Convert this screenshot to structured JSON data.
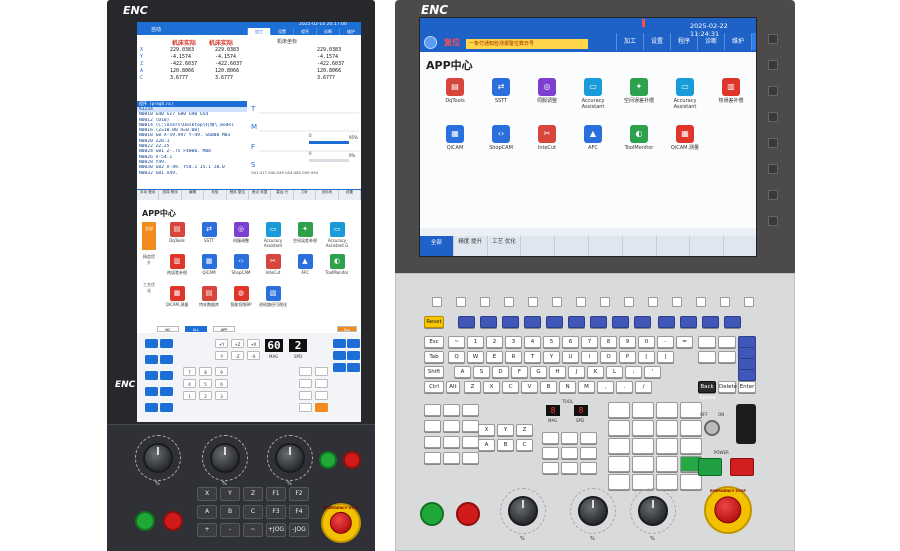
{
  "left": {
    "logo": "ENC",
    "screen": {
      "mode": "自动",
      "time": "2025-02-14 20:17:00",
      "tabs": [
        {
          "label": "加工",
          "active": true
        },
        {
          "label": "设置",
          "active": false
        },
        {
          "label": "程序",
          "active": false
        },
        {
          "label": "诊断",
          "active": false
        },
        {
          "label": "维护",
          "active": false
        }
      ],
      "coord_headers": [
        "机床实际",
        "机床实际",
        "机床坐标"
      ],
      "axes": [
        {
          "axis": "X",
          "v1": "229.0383",
          "v2": "229.0383"
        },
        {
          "axis": "Y",
          "v1": "-4.1574",
          "v2": "-4.1574"
        },
        {
          "axis": "Z",
          "v1": "-422.6037",
          "v2": "-422.6037"
        },
        {
          "axis": "A",
          "v1": "120.8066",
          "v2": "120.8066"
        },
        {
          "axis": "C",
          "v1": "3.6777",
          "v2": "3.6777"
        }
      ],
      "coord_right": [
        "229.0383",
        "-4.1574",
        "-422.6037",
        "120.8066",
        "3.6777"
      ],
      "program_title": "程序 (prog0.nc)",
      "program_lines": [
        "%1234",
        "N0010 G40 G17 G00 G90 G54",
        "N0012 (D10)",
        "N0014 (C:\\Users\\Desktop\\打样\\_model",
        "N0016 (Z=10.00 R=0.00)",
        "N0018 G0 X-59.997 Y-49. S6000 M03",
        "N0020 Z20.1",
        "N0022 Z2.25",
        "N0024 G01 Z-.75 F4000. M08",
        "N0026 X-54.1",
        "N0028 Y49.",
        "N0030 G02 X-49. Y54.1 I5.1 J0.0",
        "N0032 G01 X49."
      ],
      "status": {
        "T": "T",
        "M": "M",
        "F": "F",
        "S": "S",
        "gcodes": "G01 G17 G40 G49 G54 G80 G90 G94",
        "feed": "0",
        "speed": "0",
        "pct1": "95%",
        "pct2": "0%"
      },
      "softkeys": [
        "手动 程序",
        "选择 程序",
        "编辑",
        "校验",
        "程序 复位",
        "断点 恢复",
        "重运 行",
        "刀补",
        "坐标系",
        "设置"
      ],
      "app_title": "APP中心",
      "app_side": [
        "全部",
        "精度提升",
        "工艺优化"
      ],
      "apps": [
        {
          "label": "DqTools",
          "color": "#d6463c",
          "glyph": "▤"
        },
        {
          "label": "SSTT",
          "color": "#2a6fdc",
          "glyph": "⇄"
        },
        {
          "label": "伺服调整",
          "color": "#7c3fd0",
          "glyph": "◎"
        },
        {
          "label": "Accuracy Assistant",
          "color": "#1a9bd9",
          "glyph": "▭"
        },
        {
          "label": "空间误差补偿",
          "color": "#2da14b",
          "glyph": "✦"
        },
        {
          "label": "Accuracy Assistant.G",
          "color": "#1a9bd9",
          "glyph": "▭"
        },
        {
          "label": "热误差补偿",
          "color": "#e0352b",
          "glyph": "▥"
        },
        {
          "label": "QiCAM",
          "color": "#2a6fdc",
          "glyph": "▦"
        },
        {
          "label": "ShopCAM",
          "color": "#2a6fdc",
          "glyph": "‹›"
        },
        {
          "label": "InteCut",
          "color": "#d6463c",
          "glyph": "✂"
        },
        {
          "label": "AFC",
          "color": "#2a6fdc",
          "glyph": "▲"
        },
        {
          "label": "ToolMonitor",
          "color": "#2da14b",
          "glyph": "◐"
        },
        {
          "label": "QiCAM.测量",
          "color": "#e0352b",
          "glyph": "▦"
        },
        {
          "label": "特本数据库",
          "color": "#d6463c",
          "glyph": "▤"
        },
        {
          "label": "智能切削BP",
          "color": "#e0352b",
          "glyph": "◍"
        },
        {
          "label": "进给路径可视化",
          "color": "#2a6fdc",
          "glyph": "▧"
        }
      ],
      "bottom_tabs": [
        "NC",
        "ALL",
        "APP"
      ],
      "bottom_tab_active": 1,
      "esc": "Esc",
      "seg_mag": "60",
      "seg_spd": "2",
      "seg_mag_lbl": "MAG",
      "seg_spd_lbl": "SPD",
      "keys": [
        "+Y",
        "+Z",
        "+X",
        "-Y",
        "-Z",
        "-X",
        "7",
        "8",
        "9",
        "4",
        "5",
        "6",
        "1",
        "2",
        "3"
      ]
    },
    "panel": {
      "dial_labels": [
        "%",
        "%",
        "%"
      ],
      "keys": [
        "X",
        "Y",
        "Z",
        "F1",
        "F2",
        "A",
        "B",
        "C",
        "F3",
        "F4",
        "+",
        "-",
        "~",
        "+JOG",
        "-JOG"
      ],
      "estop_text": "EMERGENCY STOP"
    }
  },
  "right": {
    "logo": "ENC",
    "screen": {
      "time": "2025-02-22 11:24:31",
      "mode": "复位",
      "warning": "一条付通知检测报警位数日号",
      "tabs": [
        {
          "label": "加工",
          "active": false
        },
        {
          "label": "设置",
          "active": false
        },
        {
          "label": "程序",
          "active": false
        },
        {
          "label": "诊断",
          "active": false
        },
        {
          "label": "维护",
          "active": false
        },
        {
          "label": "APP",
          "active": true
        }
      ],
      "app_title": "APP中心",
      "apps": [
        {
          "label": "DqTools",
          "color": "#d6463c",
          "glyph": "▤"
        },
        {
          "label": "SSTT",
          "color": "#2a6fdc",
          "glyph": "⇄"
        },
        {
          "label": "伺服调整",
          "color": "#7c3fd0",
          "glyph": "◎"
        },
        {
          "label": "Accuracy Assistant",
          "color": "#1a9bd9",
          "glyph": "▭"
        },
        {
          "label": "空间误差补偿",
          "color": "#2da14b",
          "glyph": "✦"
        },
        {
          "label": "Accuracy Assistant",
          "color": "#1a9bd9",
          "glyph": "▭"
        },
        {
          "label": "热误差补偿",
          "color": "#e0352b",
          "glyph": "▥"
        },
        {
          "label": "QiCAM",
          "color": "#2a6fdc",
          "glyph": "▦"
        },
        {
          "label": "ShopCAM",
          "color": "#2a6fdc",
          "glyph": "‹›"
        },
        {
          "label": "InteCut",
          "color": "#d6463c",
          "glyph": "✂"
        },
        {
          "label": "AFC",
          "color": "#2a6fdc",
          "glyph": "▲"
        },
        {
          "label": "ToolMonitor",
          "color": "#2da14b",
          "glyph": "◐"
        },
        {
          "label": "QiCAM.测量",
          "color": "#e0352b",
          "glyph": "▦"
        }
      ],
      "softkeys": [
        {
          "label": "全部",
          "active": true
        },
        {
          "label": "精度 提升",
          "active": false
        },
        {
          "label": "工艺 优化",
          "active": false
        },
        {
          "label": "",
          "active": false
        },
        {
          "label": "",
          "active": false
        },
        {
          "label": "",
          "active": false
        },
        {
          "label": "",
          "active": false
        },
        {
          "label": "",
          "active": false
        },
        {
          "label": "",
          "active": false
        },
        {
          "label": "",
          "active": false
        }
      ]
    },
    "panel": {
      "row1_keys": [
        "Reset",
        "",
        "",
        "",
        "",
        "",
        "",
        "",
        "",
        "",
        "",
        "",
        "",
        ""
      ],
      "num_row": [
        "~",
        "1",
        "2",
        "3",
        "4",
        "5",
        "6",
        "7",
        "8",
        "9",
        "0",
        "-",
        "="
      ],
      "qwerty": [
        "Q",
        "W",
        "E",
        "R",
        "T",
        "Y",
        "U",
        "I",
        "O",
        "P",
        "[",
        "]"
      ],
      "asdf": [
        "A",
        "S",
        "D",
        "F",
        "G",
        "H",
        "J",
        "K",
        "L",
        ";",
        "'"
      ],
      "zxcv": [
        "Z",
        "X",
        "C",
        "V",
        "B",
        "N",
        "M",
        ",",
        ".",
        "/"
      ],
      "left_keys": [
        "Esc",
        "Tab",
        "Shift",
        "Ctrl",
        "Alt"
      ],
      "right_keys": [
        "Back Space",
        "Delete",
        "Enter"
      ],
      "axis_keys": [
        "X",
        "Y",
        "Z",
        "A",
        "B",
        "C"
      ],
      "seg_mag": "8",
      "seg_spd": "8",
      "seg_lbl_mag": "MAG",
      "seg_lbl_spd": "SPD",
      "seg_tool": "TOOL",
      "power_label": "POWER",
      "off_on": [
        "OFF",
        "ON"
      ],
      "dial_labels": [
        "%",
        "%",
        "%"
      ],
      "estop_text": "EMERGENCY STOP"
    }
  }
}
